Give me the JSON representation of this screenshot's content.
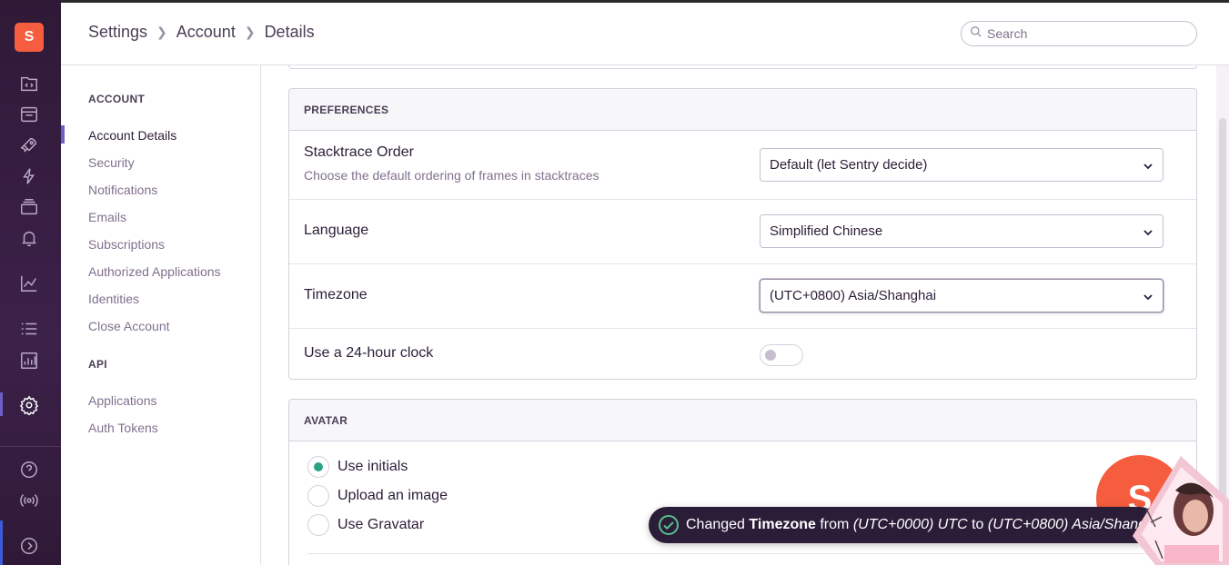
{
  "org": {
    "initial": "S"
  },
  "rail": {
    "icons": [
      "projects-icon",
      "issues-icon",
      "performance-icon",
      "releases-icon",
      "discover-icon",
      "alerts-icon",
      "stats-icon",
      "activity-icon",
      "dashboards-icon",
      "settings-icon",
      "help-icon",
      "broadcasts-icon",
      "collapse-icon"
    ],
    "active": "settings-icon"
  },
  "header": {
    "breadcrumb": [
      "Settings",
      "Account",
      "Details"
    ],
    "search_placeholder": "Search"
  },
  "subnav": {
    "sections": [
      {
        "heading": "ACCOUNT",
        "items": [
          "Account Details",
          "Security",
          "Notifications",
          "Emails",
          "Subscriptions",
          "Authorized Applications",
          "Identities",
          "Close Account"
        ],
        "active": "Account Details"
      },
      {
        "heading": "API",
        "items": [
          "Applications",
          "Auth Tokens"
        ]
      }
    ]
  },
  "preferences": {
    "title": "PREFERENCES",
    "stacktrace": {
      "label": "Stacktrace Order",
      "help": "Choose the default ordering of frames in stacktraces",
      "value": "Default (let Sentry decide)"
    },
    "language": {
      "label": "Language",
      "value": "Simplified Chinese"
    },
    "timezone": {
      "label": "Timezone",
      "value": "(UTC+0800) Asia/Shanghai"
    },
    "clock": {
      "label": "Use a 24-hour clock",
      "enabled": false
    }
  },
  "avatar": {
    "title": "AVATAR",
    "options": [
      "Use initials",
      "Upload an image",
      "Use Gravatar"
    ],
    "selected": "Use initials",
    "preview_initial": "S"
  },
  "toast": {
    "prefix": "Changed",
    "field": "Timezone",
    "from_word": "from",
    "old_value": "(UTC+0000) UTC",
    "to_word": "to",
    "new_value": "(UTC+0800) Asia/Shanghai"
  },
  "colors": {
    "accent": "#6c5fc7",
    "org_badge": "#f55d3e",
    "sidebar": "#2f1937",
    "success": "#2ba185"
  }
}
